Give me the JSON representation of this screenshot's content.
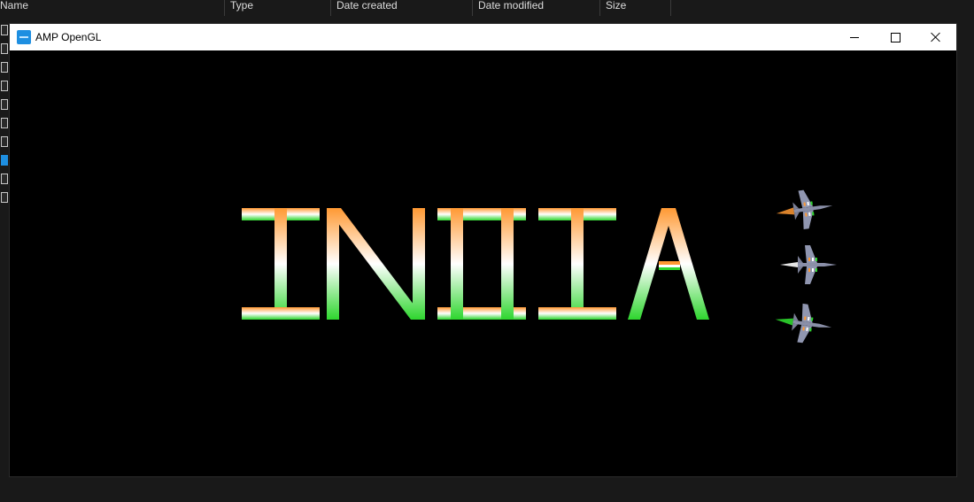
{
  "explorer": {
    "columns": [
      "Name",
      "Type",
      "Date created",
      "Date modified",
      "Size"
    ]
  },
  "window": {
    "title": "AMP OpenGL",
    "icon": "opengl-app-icon",
    "controls": [
      "minimize-icon",
      "maximize-icon",
      "close-icon"
    ]
  },
  "scene": {
    "text": "INDIA",
    "colors": {
      "saffron": "#ff9933",
      "white": "#ffffff",
      "green": "#2ed62e",
      "jet_body": "#8a8fa8",
      "background": "#000000"
    },
    "jets": [
      {
        "name": "top-jet",
        "trail": "saffron"
      },
      {
        "name": "middle-jet",
        "trail": "white"
      },
      {
        "name": "bottom-jet",
        "trail": "green"
      }
    ]
  }
}
